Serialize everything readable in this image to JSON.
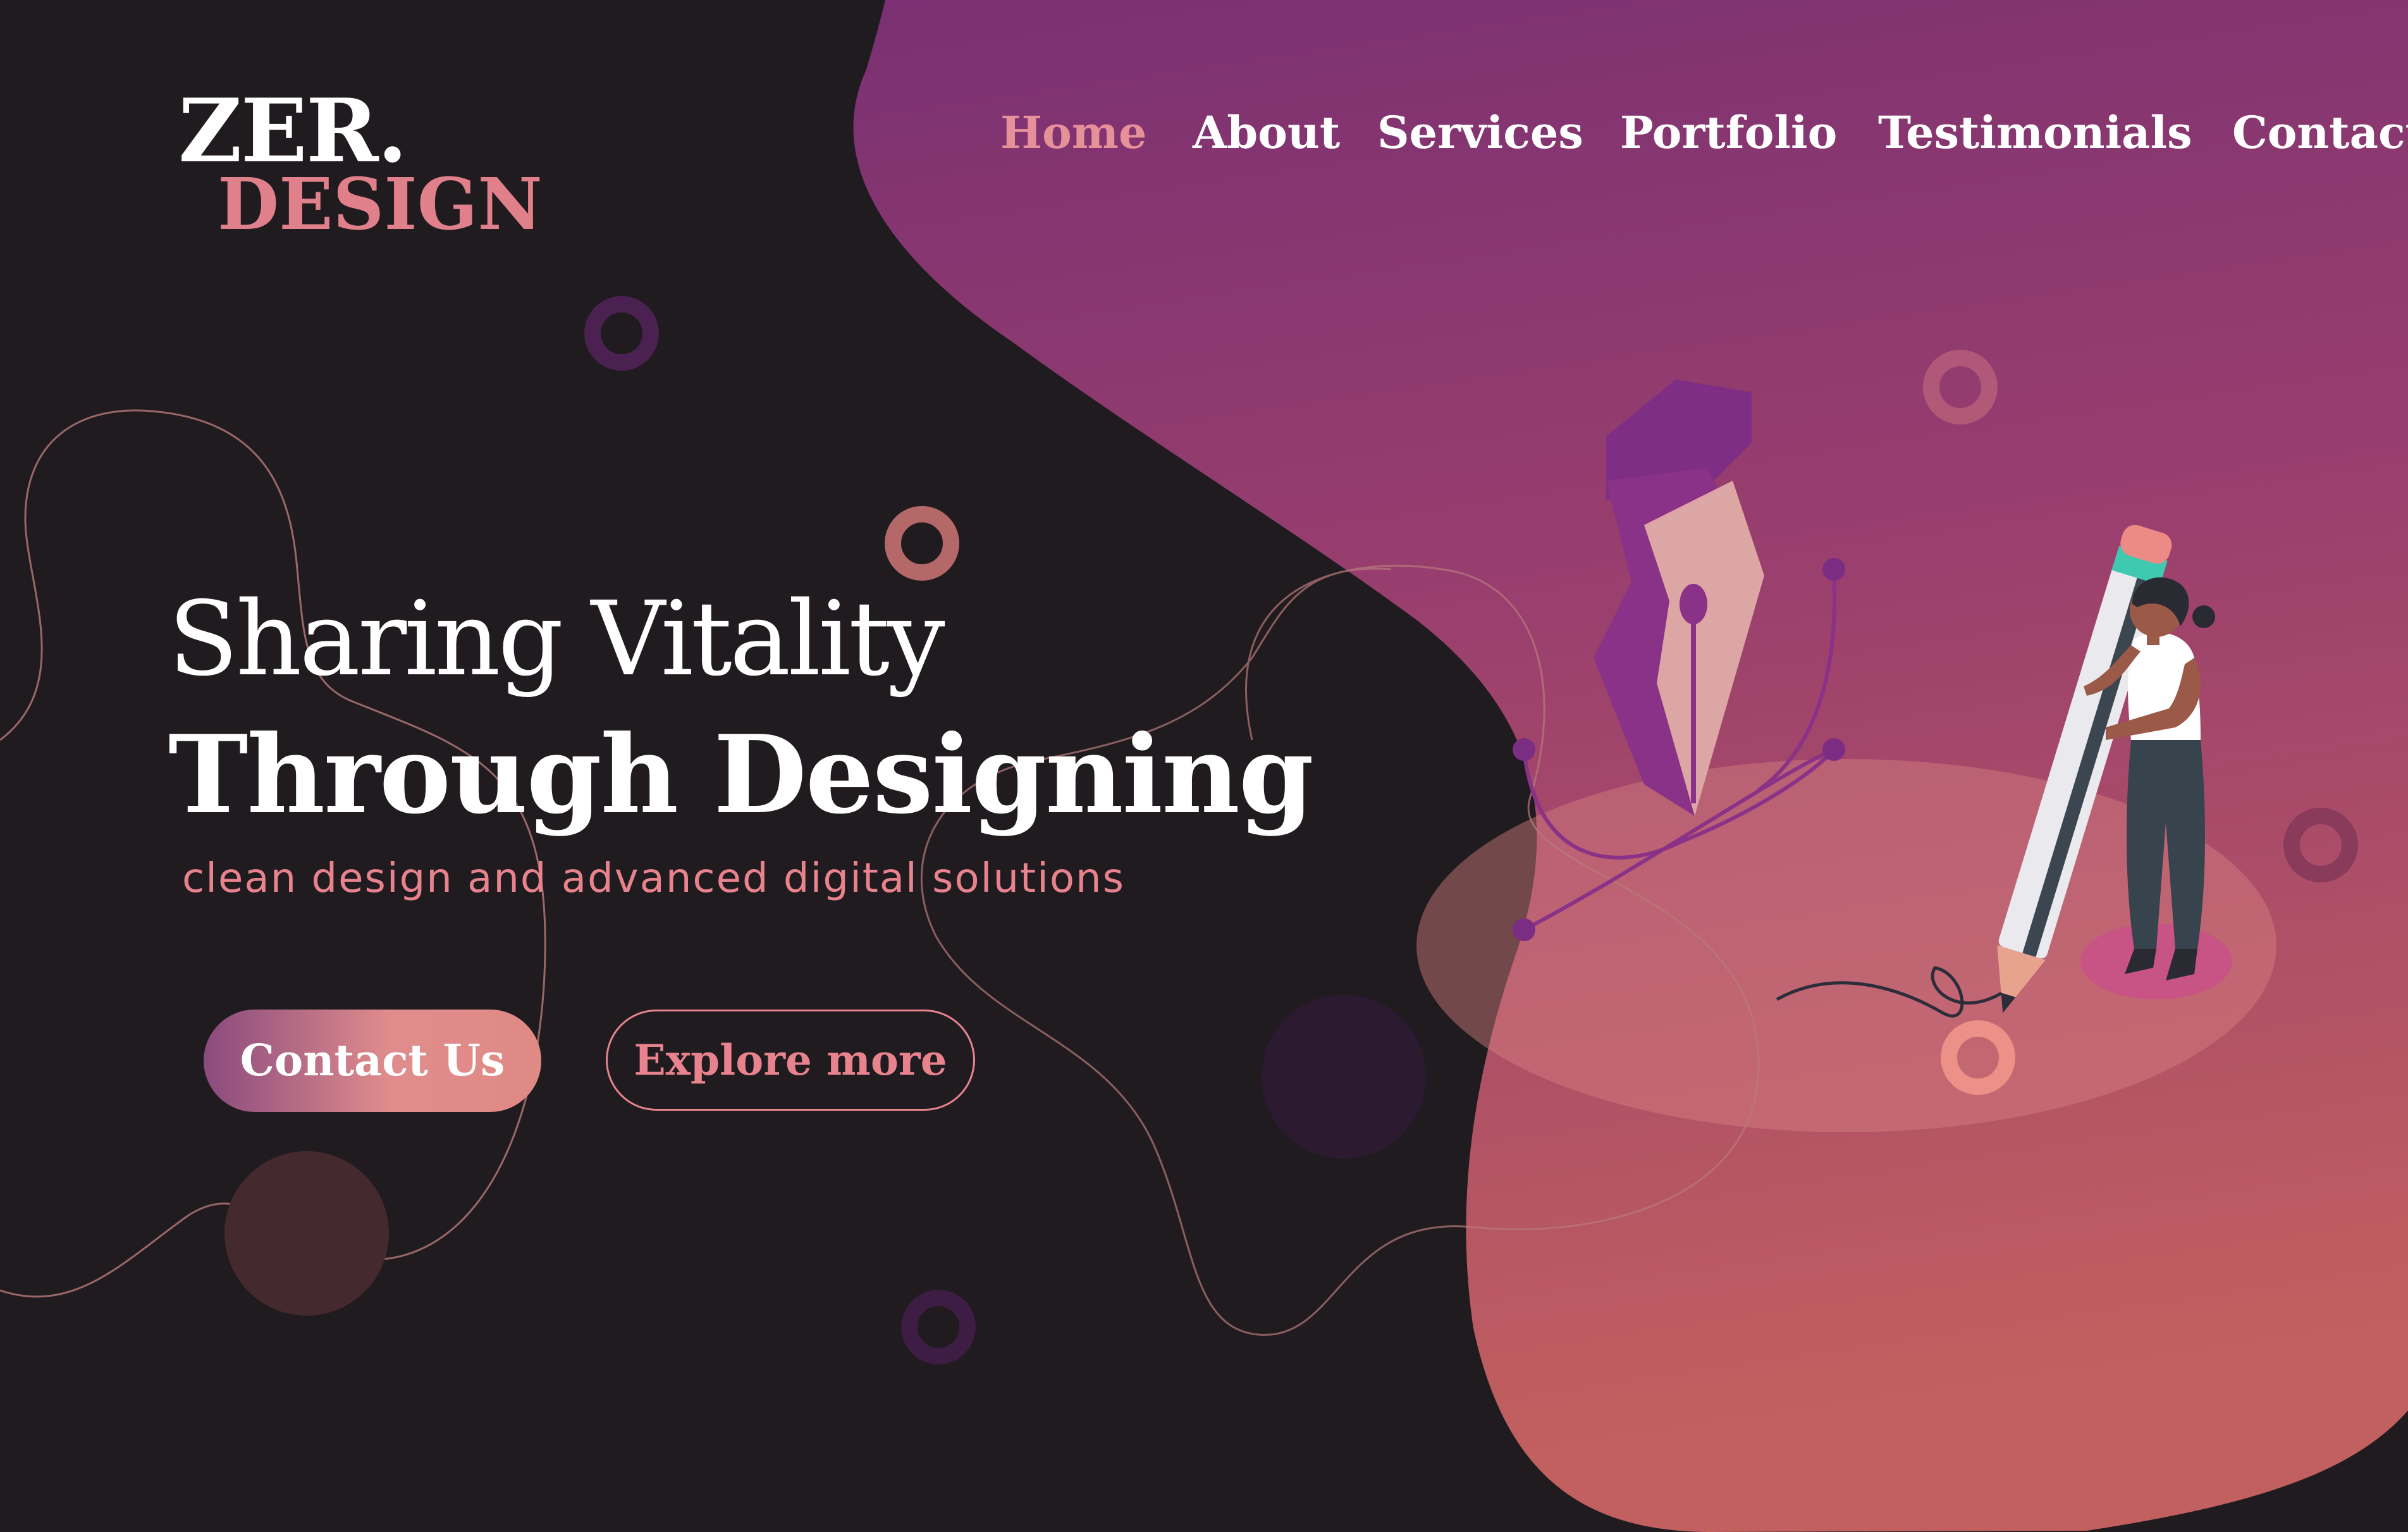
{
  "brand": {
    "name_top": "ZER.",
    "name_bottom": "DESIGN"
  },
  "nav": {
    "items": [
      {
        "label": "Home",
        "active": true
      },
      {
        "label": "About",
        "active": false
      },
      {
        "label": "Services",
        "active": false
      },
      {
        "label": "Portfolio",
        "active": false
      },
      {
        "label": "Testimonials",
        "active": false
      },
      {
        "label": "Contact",
        "active": false
      }
    ]
  },
  "hero": {
    "title_line1": "Sharing Vitality",
    "title_line2": "Through Designing",
    "subtitle": "clean design and advanced digital solutions"
  },
  "buttons": {
    "primary": "Contact Us",
    "secondary": "Explore more"
  },
  "illustration": {
    "subject": "woman-holding-giant-pencil-icon",
    "secondary": "pen-nib-icon"
  },
  "colors": {
    "background": "#1f1b1f",
    "accent": "#e8838e",
    "blob_top": "#7a3272",
    "blob_bottom": "#c96464",
    "nav_active": "#e6909a"
  }
}
